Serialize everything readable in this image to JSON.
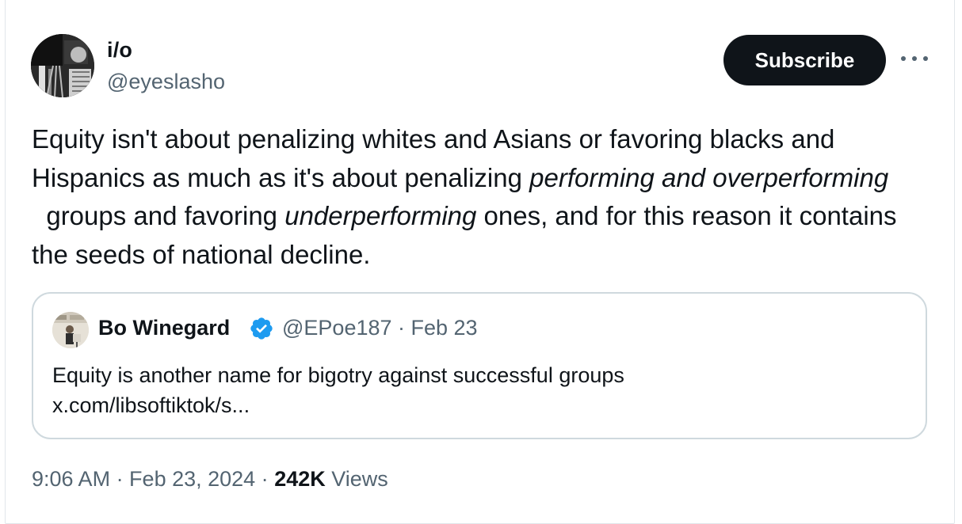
{
  "author": {
    "display_name": "i/o",
    "handle": "@eyeslasho"
  },
  "actions": {
    "subscribe_label": "Subscribe",
    "more_icon": "more-horizontal-icon"
  },
  "tweet": {
    "text_part1": "Equity isn't about penalizing whites and Asians or favoring blacks and Hispanics as much as it's about penalizing ",
    "italic1": "performing and overperforming",
    "text_part2": "  groups and favoring ",
    "italic2": "underperforming",
    "text_part3": " ones, and for this reason it contains the seeds of national decline."
  },
  "quoted": {
    "display_name": "Bo Winegard",
    "verified_icon": "verified-badge-icon",
    "meta": "@EPoe187 · Feb 23",
    "text_line1": "Equity is another name for bigotry against successful groups",
    "text_line2": "x.com/libsoftiktok/s..."
  },
  "footer": {
    "time_date": "9:06 AM · Feb 23, 2024 · ",
    "views_count": "242K",
    "views_label": " Views"
  },
  "colors": {
    "text_primary": "#0f1419",
    "text_secondary": "#536471",
    "border": "#cfd9de",
    "verified": "#1d9bf0",
    "button_bg": "#0f1419"
  }
}
